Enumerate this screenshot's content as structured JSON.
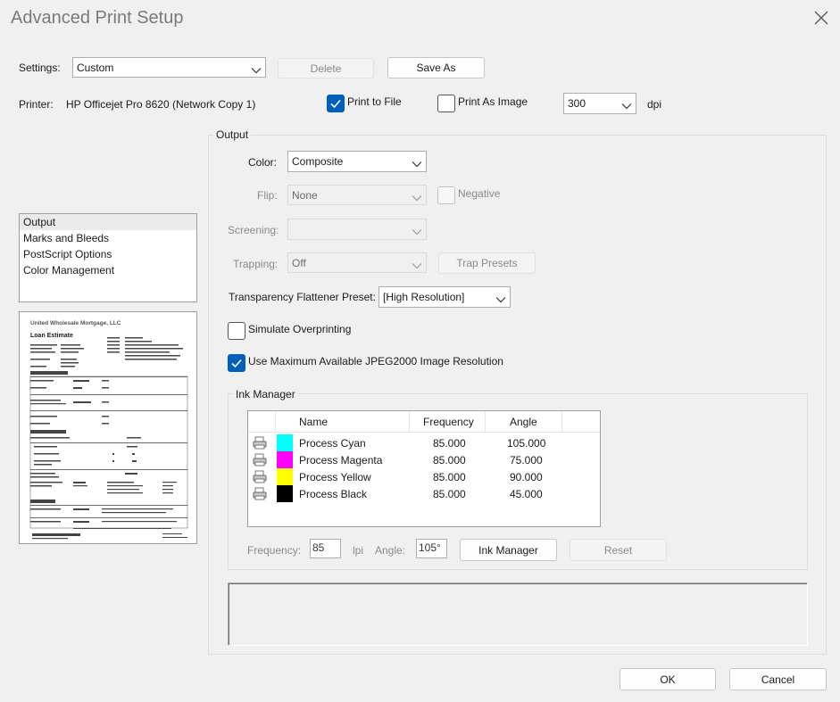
{
  "window": {
    "title": "Advanced Print Setup"
  },
  "settings": {
    "label": "Settings:",
    "value": "Custom",
    "delete_label": "Delete",
    "save_as_label": "Save As"
  },
  "printer": {
    "label": "Printer:",
    "name": "HP Officejet Pro 8620 (Network Copy 1)",
    "print_to_file_label": "Print to File",
    "print_to_file_checked": true,
    "print_as_image_label": "Print As Image",
    "print_as_image_checked": false,
    "dpi_value": "300",
    "dpi_unit": "dpi"
  },
  "sidebar": {
    "items": [
      {
        "label": "Output",
        "selected": true
      },
      {
        "label": "Marks and Bleeds",
        "selected": false
      },
      {
        "label": "PostScript Options",
        "selected": false
      },
      {
        "label": "Color Management",
        "selected": false
      }
    ]
  },
  "preview": {
    "company": "United Wholesale Mortgage, LLC",
    "doc_title": "Loan Estimate"
  },
  "output": {
    "group_label": "Output",
    "color_label": "Color:",
    "color_value": "Composite",
    "flip_label": "Flip:",
    "flip_value": "None",
    "negative_label": "Negative",
    "screening_label": "Screening:",
    "screening_value": "",
    "trapping_label": "Trapping:",
    "trapping_value": "Off",
    "trap_presets_label": "Trap Presets",
    "transparency_label": "Transparency Flattener Preset:",
    "transparency_value": "[High Resolution]",
    "simulate_label": "Simulate Overprinting",
    "simulate_checked": false,
    "jpeg2000_label": "Use Maximum Available JPEG2000 Image Resolution",
    "jpeg2000_checked": true
  },
  "ink_manager": {
    "group_label": "Ink Manager",
    "columns": [
      "Name",
      "Frequency",
      "Angle"
    ],
    "rows": [
      {
        "name": "Process Cyan",
        "frequency": "85.000",
        "angle": "105.000",
        "color": "#00ffff"
      },
      {
        "name": "Process Magenta",
        "frequency": "85.000",
        "angle": "75.000",
        "color": "#ff00ff"
      },
      {
        "name": "Process Yellow",
        "frequency": "85.000",
        "angle": "90.000",
        "color": "#ffff00"
      },
      {
        "name": "Process Black",
        "frequency": "85.000",
        "angle": "45.000",
        "color": "#000000"
      }
    ],
    "frequency_label": "Frequency:",
    "frequency_value": "85",
    "lpi_label": "lpi",
    "angle_label": "Angle:",
    "angle_value": "105°",
    "ink_manager_button": "Ink Manager",
    "reset_button": "Reset"
  },
  "footer": {
    "ok_label": "OK",
    "cancel_label": "Cancel"
  },
  "colors": {
    "accent": "#005fb8",
    "background": "#f0f0f0"
  }
}
